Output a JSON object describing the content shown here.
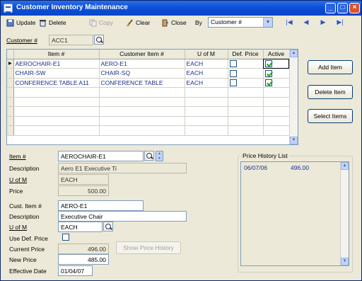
{
  "window": {
    "title": "Customer Inventory Maintenance"
  },
  "toolbar": {
    "update": "Update",
    "delete": "Delete",
    "copy": "Copy",
    "clear": "Clear",
    "close": "Close",
    "by_label": "By",
    "by_value": "Customer #"
  },
  "customer": {
    "label": "Customer #",
    "value": "ACC1"
  },
  "grid": {
    "headers": [
      "Item #",
      "Customer Item #",
      "U of M",
      "Def. Price",
      "Active"
    ],
    "rows": [
      {
        "item": "AEROCHAIR-E1",
        "cust_item": "AERO-E1",
        "uom": "EACH",
        "def_price": false,
        "active": true
      },
      {
        "item": "CHAIR-SW",
        "cust_item": "CHAIR-SQ",
        "uom": "EACH",
        "def_price": false,
        "active": true
      },
      {
        "item": "CONFERENCE TABLE A11",
        "cust_item": "CONFERENCE TABLE",
        "uom": "EACH",
        "def_price": false,
        "active": true
      }
    ]
  },
  "buttons": {
    "add_item": "Add Item",
    "delete_item": "Delete Item",
    "select_items": "Select Items",
    "show_price_history": "Show Price History"
  },
  "item": {
    "item_label": "Item #",
    "item_value": "AEROCHAIR-E1",
    "desc_label": "Description",
    "desc_value": "Aero E1 Executive Ti",
    "uom_label": "U of M",
    "uom_value": "EACH",
    "price_label": "Price",
    "price_value": "500.00"
  },
  "cust": {
    "item_label": "Cust. Item #",
    "item_value": "AERO-E1",
    "desc_label": "Description",
    "desc_value": "Executive Chair",
    "uom_label": "U of M",
    "uom_value": "EACH",
    "use_def_label": "Use Def. Price",
    "current_label": "Current Price",
    "current_value": "496.00",
    "new_label": "New Price",
    "new_value": "485.00",
    "eff_label": "Effective Date",
    "eff_value": "01/04/07"
  },
  "price_history": {
    "title": "Price History List",
    "entries": [
      {
        "date": "06/07/06",
        "price": "496.00"
      }
    ]
  }
}
